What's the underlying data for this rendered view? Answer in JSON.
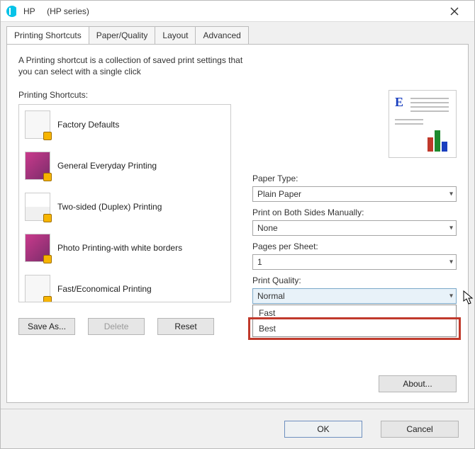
{
  "window": {
    "app": "HP",
    "subtitle": "(HP              series)"
  },
  "tabs": [
    {
      "label": "Printing Shortcuts",
      "active": true
    },
    {
      "label": "Paper/Quality",
      "active": false
    },
    {
      "label": "Layout",
      "active": false
    },
    {
      "label": "Advanced",
      "active": false
    }
  ],
  "description": "A Printing shortcut is a collection of saved print settings that you can select with a single click",
  "shortcuts": {
    "title": "Printing Shortcuts:",
    "items": [
      {
        "label": "Factory Defaults",
        "iconType": "page"
      },
      {
        "label": "General Everyday Printing",
        "iconType": "photo"
      },
      {
        "label": "Two-sided (Duplex) Printing",
        "iconType": "duplex"
      },
      {
        "label": "Photo Printing-with white borders",
        "iconType": "photo"
      },
      {
        "label": "Fast/Economical Printing",
        "iconType": "page"
      }
    ]
  },
  "buttons": {
    "saveAs": "Save As...",
    "delete": "Delete",
    "reset": "Reset",
    "about": "About...",
    "ok": "OK",
    "cancel": "Cancel"
  },
  "settings": {
    "paperType": {
      "label": "Paper Type:",
      "value": "Plain Paper"
    },
    "duplex": {
      "label": "Print on Both Sides Manually:",
      "value": "None"
    },
    "pagesPerSheet": {
      "label": "Pages per Sheet:",
      "value": "1"
    },
    "quality": {
      "label": "Print Quality:",
      "value": "Normal",
      "options": [
        "Fast",
        "Best"
      ]
    }
  }
}
